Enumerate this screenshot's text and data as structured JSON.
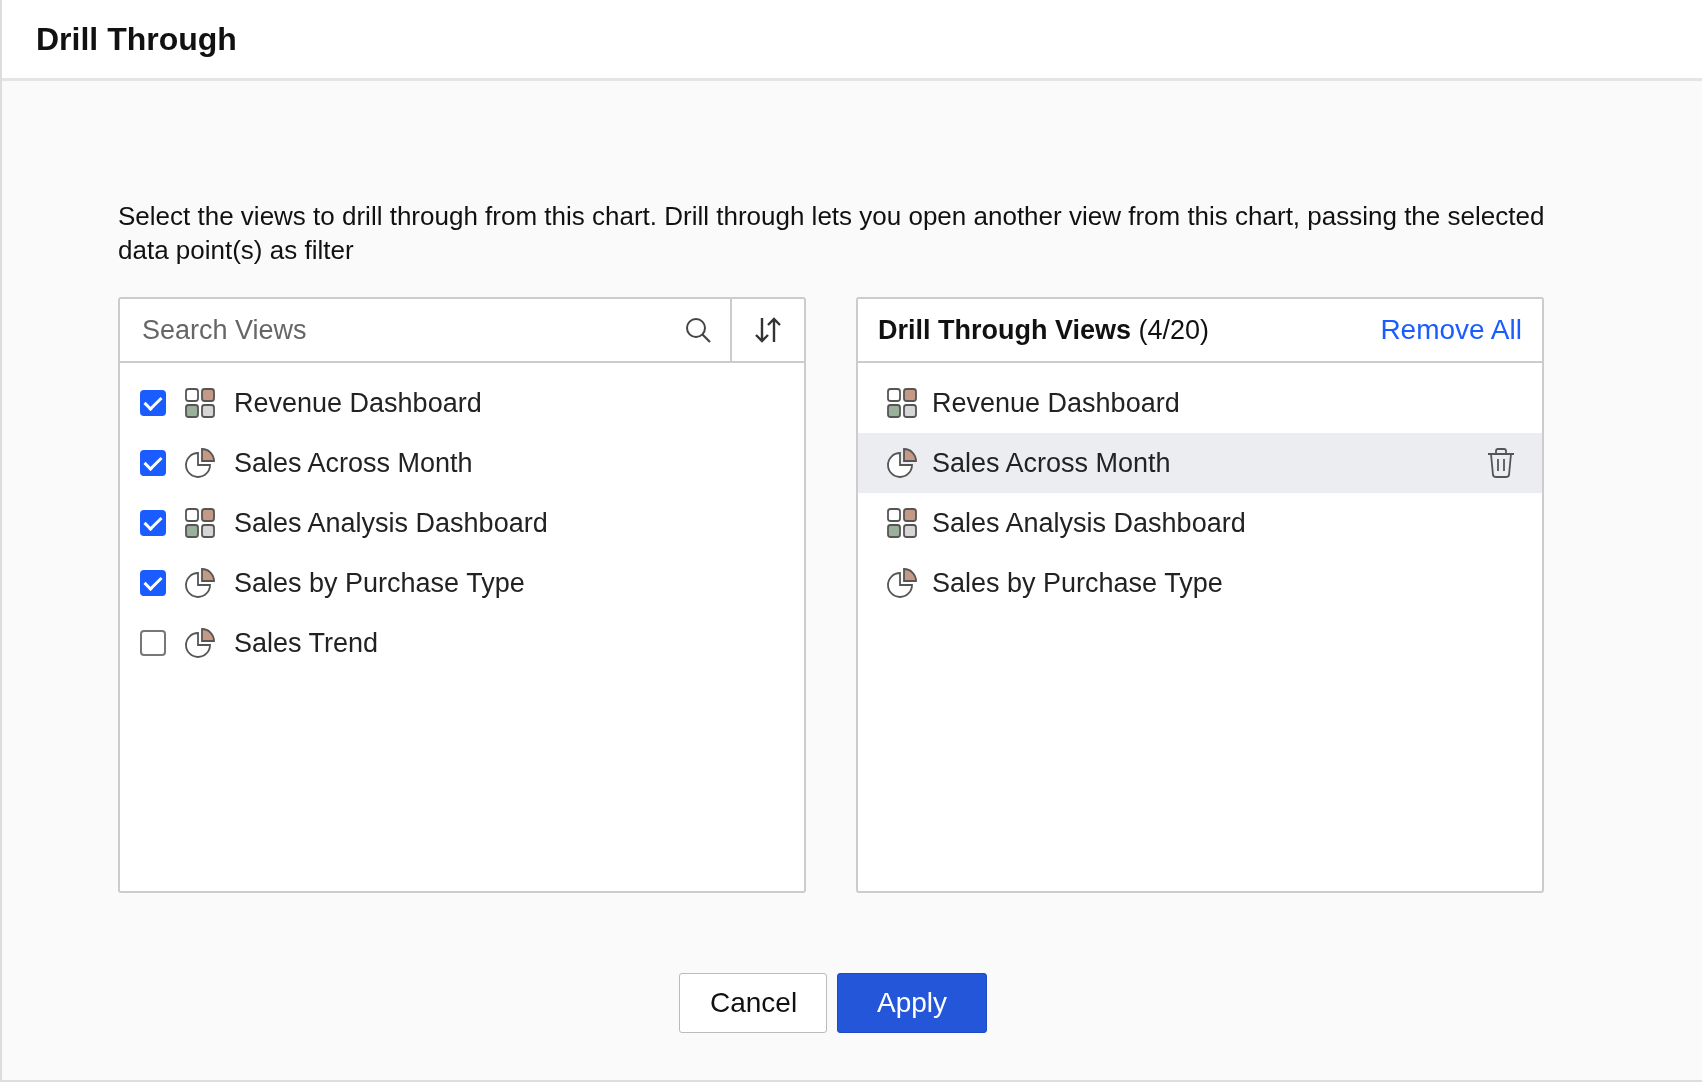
{
  "dialog": {
    "title": "Drill Through"
  },
  "description": "Select the views to drill through from this chart. Drill through lets you open another view from this chart, passing the selected data point(s) as filter",
  "available": {
    "search": {
      "placeholder": "Search Views"
    },
    "items": [
      {
        "label": "Revenue Dashboard",
        "kind": "dashboard",
        "checked": true
      },
      {
        "label": "Sales Across Month",
        "kind": "chart",
        "checked": true
      },
      {
        "label": "Sales Analysis Dashboard",
        "kind": "dashboard",
        "checked": true
      },
      {
        "label": "Sales by Purchase Type",
        "kind": "chart",
        "checked": true
      },
      {
        "label": "Sales Trend",
        "kind": "chart",
        "checked": false
      }
    ]
  },
  "selected_views": {
    "title": "**Drill Through Views** (4/20)",
    "remove_all": "Remove All",
    "items": [
      {
        "label": "Revenue Dashboard",
        "kind": "dashboard",
        "highlighted": false
      },
      {
        "label": "Sales Across Month",
        "kind": "chart",
        "highlighted": true
      },
      {
        "label": "Sales Analysis Dashboard",
        "kind": "dashboard",
        "highlighted": false
      },
      {
        "label": "Sales by Purchase Type",
        "kind": "chart",
        "highlighted": false
      }
    ]
  },
  "buttons": [
    {
      "label": "Cancel",
      "kind": "secondary"
    },
    {
      "label": "Apply",
      "kind": "primary"
    }
  ]
}
